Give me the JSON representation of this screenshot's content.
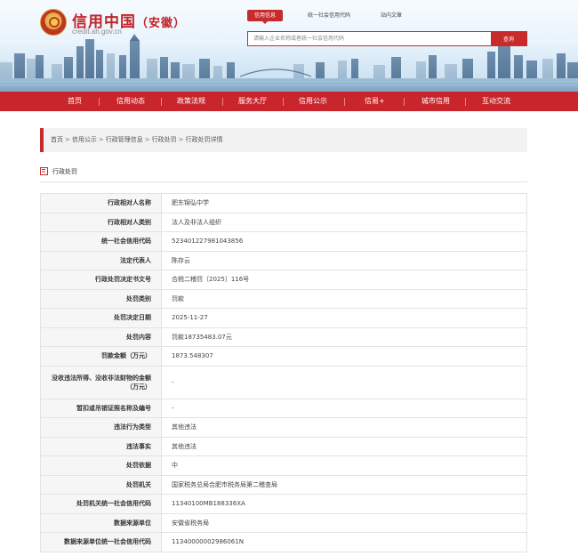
{
  "header": {
    "site_title": "信用中国",
    "site_region": "（安徽）",
    "site_url": "credit.ah.gov.cn",
    "search_tabs": [
      "信用信息",
      "统一社会信用代码",
      "站内文章"
    ],
    "search_placeholder": "请输入企业名称或者统一社会信用代码",
    "search_button": "查询"
  },
  "nav": {
    "items": [
      "首页",
      "信用动态",
      "政策法规",
      "服务大厅",
      "信用公示",
      "信易+",
      "城市信用",
      "互动交流"
    ]
  },
  "breadcrumb": [
    "首页",
    "信用公示",
    "行政管理信息",
    "行政处罚",
    "行政处罚详情"
  ],
  "section": {
    "title": "行政处罚"
  },
  "details": [
    {
      "label": "行政相对人名称",
      "value": "肥东锦弘中学"
    },
    {
      "label": "行政相对人类别",
      "value": "法人及非法人组织"
    },
    {
      "label": "统一社会信用代码",
      "value": "52340122798104385​6"
    },
    {
      "label": "法定代表人",
      "value": "陈存云"
    },
    {
      "label": "行政处罚决定书文号",
      "value": "合税二稽罚〔2025〕116号"
    },
    {
      "label": "处罚类别",
      "value": "罚款"
    },
    {
      "label": "处罚决定日期",
      "value": "2025-11-27"
    },
    {
      "label": "处罚内容",
      "value": "罚款18735483.07元"
    },
    {
      "label": "罚款金额（万元）",
      "value": "1873.548307"
    },
    {
      "label": "没收违法所得、没收非法财物的金额（万元）",
      "value": "-"
    },
    {
      "label": "暂扣或吊销证照名称及编号",
      "value": "-"
    },
    {
      "label": "违法行为类型",
      "value": "其他违法"
    },
    {
      "label": "违法事实",
      "value": "其他违法"
    },
    {
      "label": "处罚依据",
      "value": "中"
    },
    {
      "label": "处罚机关",
      "value": "国家税务总局合肥市税务局第二稽查局"
    },
    {
      "label": "处罚机关统一社会信用代码",
      "value": "11340100MB188336XA"
    },
    {
      "label": "数据来源单位",
      "value": "安徽省税务局"
    },
    {
      "label": "数据来源单位统一社会信用代码",
      "value": "11340000002986061N"
    }
  ],
  "colors": {
    "brand_red": "#c8262c",
    "label_bg": "#f6f6f6",
    "border": "#e3e3e3"
  }
}
